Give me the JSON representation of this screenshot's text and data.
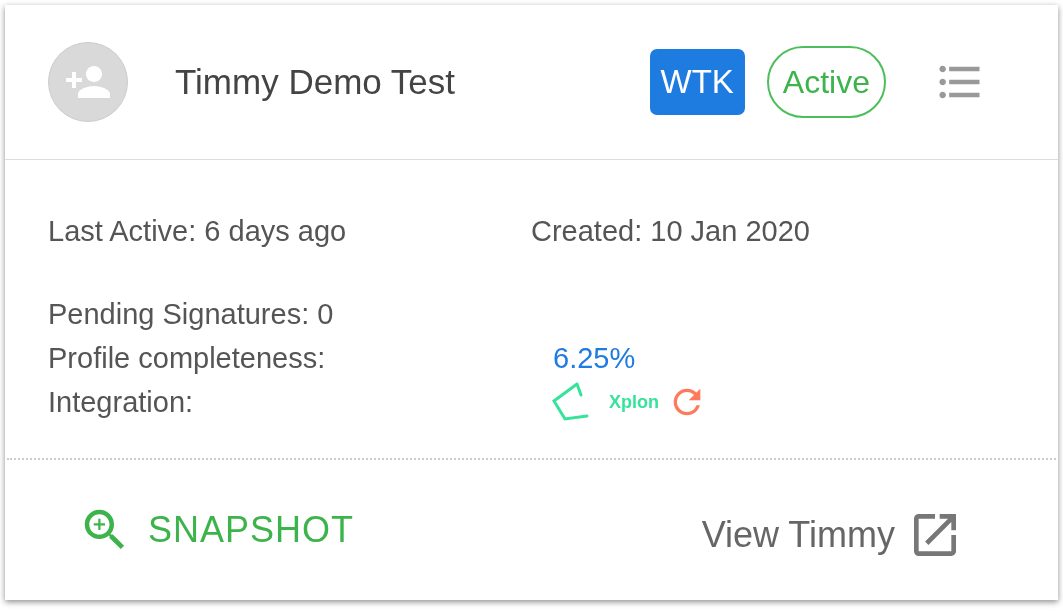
{
  "profile": {
    "name": "Timmy Demo Test",
    "badge": "WTK",
    "status": {
      "label": "Active",
      "active": true
    }
  },
  "details": {
    "last_active": "Last Active: 6 days ago",
    "created": "Created: 10 Jan 2020",
    "pending": "Pending Signatures: 0",
    "completeness_label": "Profile completeness:",
    "completeness_value": "6.25%",
    "integration_label": "Integration:",
    "integration_name": "Xplon"
  },
  "actions": {
    "snapshot": "SNAPSHOT",
    "view": "View Timmy"
  }
}
